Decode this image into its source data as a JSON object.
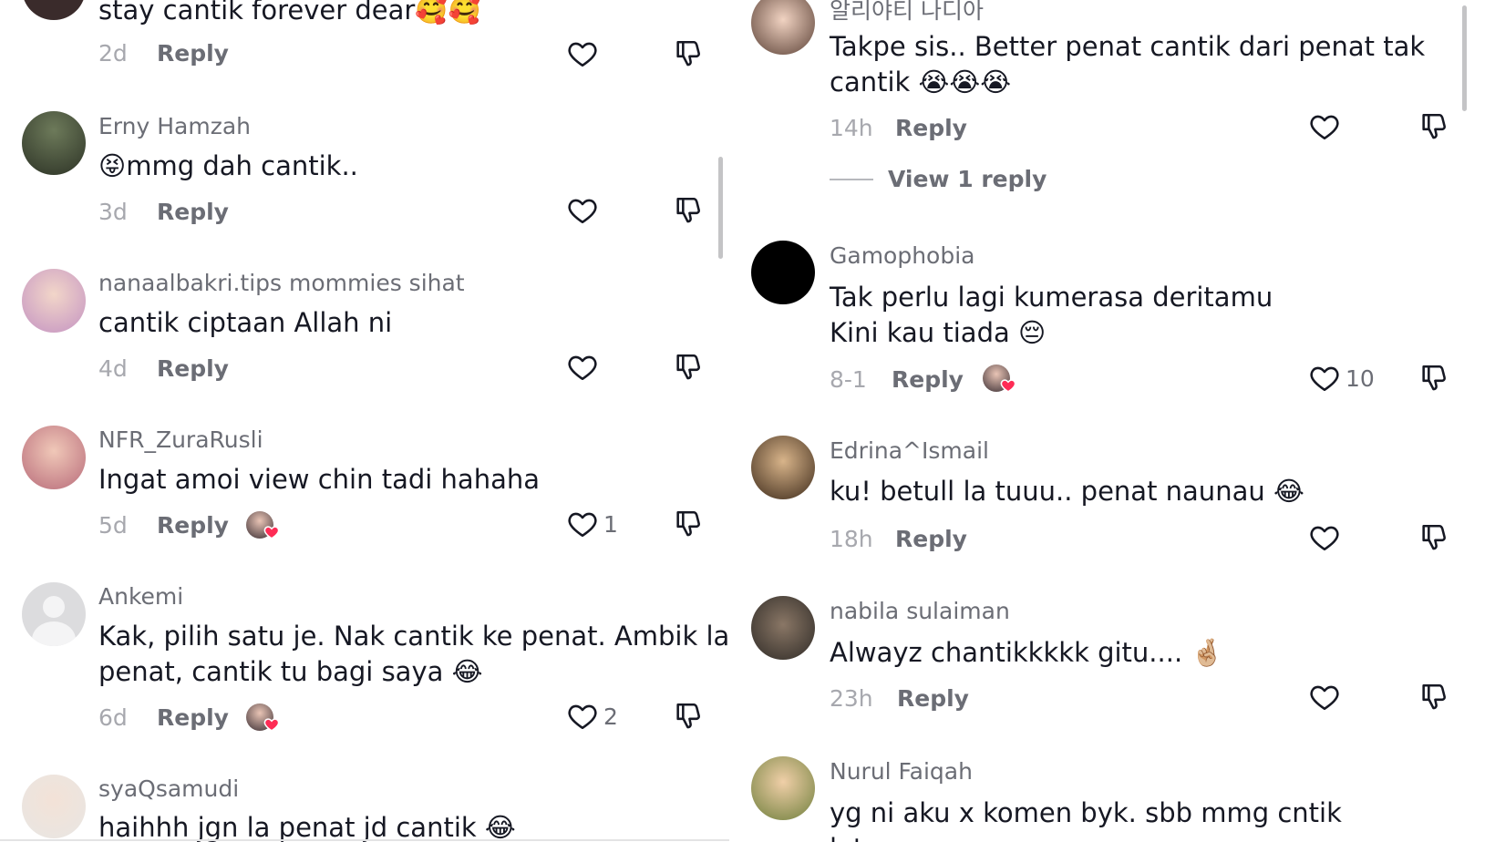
{
  "ui": {
    "reply_label": "Reply",
    "view_reply_label": "View 1 reply"
  },
  "left": [
    {
      "username": "",
      "lines": [
        "stay cantik forever dear🥰🥰"
      ],
      "time": "2d",
      "likes": ""
    },
    {
      "username": "Erny Hamzah",
      "lines": [
        "😝mmg dah cantik.."
      ],
      "time": "3d",
      "likes": ""
    },
    {
      "username": "nanaalbakri.tips mommies sihat",
      "lines": [
        "cantik ciptaan Allah ni"
      ],
      "time": "4d",
      "likes": ""
    },
    {
      "username": "NFR_ZuraRusli",
      "lines": [
        "Ingat amoi view chin tadi hahaha"
      ],
      "time": "5d",
      "likes": "1"
    },
    {
      "username": "Ankemi",
      "lines": [
        "Kak, pilih satu je. Nak cantik ke penat. Ambik la",
        "penat, cantik tu bagi saya 😂"
      ],
      "time": "6d",
      "likes": "2"
    },
    {
      "username": "syaQsamudi",
      "lines": [
        "haihhh jgn la penat jd cantik 😂"
      ],
      "time": "",
      "likes": ""
    }
  ],
  "right": [
    {
      "username": "알리야티 나디아",
      "lines": [
        "Takpe sis.. Better penat cantik dari penat tak",
        "cantik 😭😭😭"
      ],
      "time": "14h",
      "likes": ""
    },
    {
      "username": "Gamophobia",
      "lines": [
        "Tak perlu lagi kumerasa deritamu",
        "Kini kau tiada 😔"
      ],
      "time": "8-1",
      "likes": "10"
    },
    {
      "username": "Edrina^Ismail",
      "lines": [
        "ku! betull la tuuu.. penat naunau 😂"
      ],
      "time": "18h",
      "likes": ""
    },
    {
      "username": "nabila sulaiman",
      "lines": [
        "Alwayz chantikkkkk gitu.... 🤞🏼"
      ],
      "time": "23h",
      "likes": ""
    },
    {
      "username": "Nurul Faiqah",
      "lines": [
        "yg ni aku x komen byk. sbb mmg cntik",
        "lat…"
      ],
      "time": "",
      "likes": ""
    }
  ],
  "colors": {
    "text": "#161823",
    "muted": "#6b6d75",
    "time": "#a7a8ae",
    "heart_badge": "#fe2c55"
  }
}
